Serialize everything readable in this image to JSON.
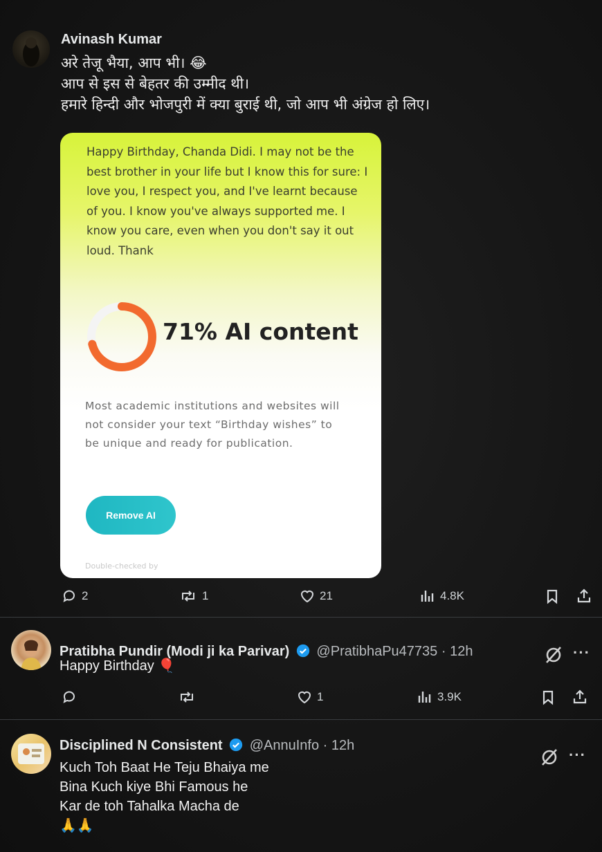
{
  "tweets": [
    {
      "name": "Avinash Kumar",
      "lines": [
        "अरे तेजू भैया, आप भी। 😂",
        "आप से इस से बेहतर की उम्मीद थी।",
        "हमारे हिन्दी और भोजपुरी में क्या बुराई थी, जो आप भी अंग्रेज हो लिए।"
      ],
      "replies": "2",
      "reposts": "1",
      "likes": "21",
      "views": "4.8K"
    },
    {
      "name": "Pratibha Pundir (Modi ji ka Parivar)",
      "handle": "@PratibhaPu47735 · 12h",
      "text": "Happy Birthday 🎈",
      "replies": "",
      "reposts": "",
      "likes": "1",
      "views": "3.9K"
    },
    {
      "name": "Disciplined N Consistent",
      "handle": "@AnnuInfo · 12h",
      "lines": [
        "Kuch Toh Baat He Teju Bhaiya me",
        "Bina Kuch kiye Bhi Famous he",
        "Kar de toh Tahalka Macha de",
        "🙏🙏"
      ]
    }
  ],
  "card": {
    "text": "Happy Birthday, Chanda Didi. I may not be the best brother in your life but I know this for sure: I love you, I respect you, and I've learnt because of you. I know you've always supported me. I know you care, even when you don't say it out loud. Thank",
    "ai_percent": 0.71,
    "ai_title": "71% AI content",
    "description": "Most academic institutions and websites will not consider your text “Birthday wishes” to be unique and ready for publication.",
    "button": "Remove AI",
    "footer": "Double-checked by"
  },
  "more_label": "···",
  "colors": {
    "verified": "#1d9bf0",
    "ring": "#f26a2e",
    "button": "#1fb7c2",
    "background": "#151515"
  }
}
